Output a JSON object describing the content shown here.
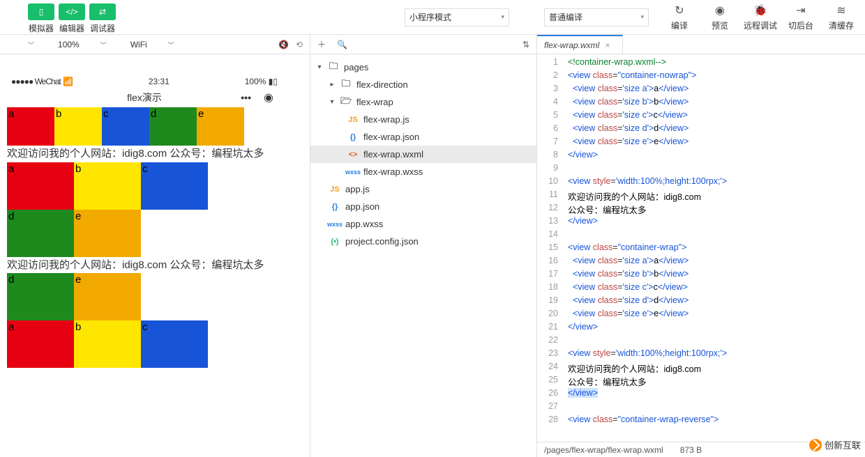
{
  "topbar": {
    "left": [
      {
        "icon": "phone-icon",
        "label": "模拟器"
      },
      {
        "icon": "code-icon",
        "label": "编辑器"
      },
      {
        "icon": "debug-icon",
        "label": "调试器"
      }
    ],
    "mode_select": "小程序模式",
    "compile_select": "普通编译",
    "right": [
      {
        "icon": "compile-icon",
        "glyph": "↻",
        "label": "编译"
      },
      {
        "icon": "preview-icon",
        "glyph": "◉",
        "label": "预览"
      },
      {
        "icon": "remote-debug-icon",
        "glyph": "⚙",
        "label": "远程调试"
      },
      {
        "icon": "background-icon",
        "glyph": "⇥",
        "label": "切后台"
      },
      {
        "icon": "cache-icon",
        "glyph": "≋",
        "label": "清缓存"
      }
    ]
  },
  "secondbar": {
    "zoom": "100%",
    "network": "WiFi",
    "mute_icon": "🔇",
    "cast_icon": "📡"
  },
  "simulator": {
    "status_left": "●●●●● WeChat",
    "wifi_icon": "📶",
    "time": "23:31",
    "battery_pct": "100%",
    "title": "flex演示",
    "welcome": "欢迎访问我的个人网站：idig8.com 公众号：编程坑太多",
    "row1": [
      "a",
      "b",
      "c",
      "d",
      "e"
    ],
    "row2": [
      "a",
      "b",
      "c"
    ],
    "row2b": [
      "d",
      "e"
    ],
    "row3_top": [
      "d",
      "e"
    ],
    "row3_bot": [
      "a",
      "b",
      "c"
    ]
  },
  "tree": {
    "root": "pages",
    "flex_direction": "flex-direction",
    "flex_wrap": "flex-wrap",
    "files": {
      "js": "flex-wrap.js",
      "json": "flex-wrap.json",
      "wxml": "flex-wrap.wxml",
      "wxss": "flex-wrap.wxss"
    },
    "app_js": "app.js",
    "app_json": "app.json",
    "app_wxss": "app.wxss",
    "project_config": "project.config.json"
  },
  "editor": {
    "tab_name": "flex-wrap.wxml",
    "status_path": "/pages/flex-wrap/flex-wrap.wxml",
    "status_size": "873 B",
    "lines": [
      {
        "n": 1,
        "html": "<span class='c-com'>&lt;!container-wrap.wxml--&gt;</span>"
      },
      {
        "n": 2,
        "html": "<span class='c-tag'>&lt;view</span> <span class='c-attr'>class</span>=<span class='c-str'>\"container-nowrap\"</span><span class='c-tag'>&gt;</span>"
      },
      {
        "n": 3,
        "html": "  <span class='c-tag'>&lt;view</span> <span class='c-attr'>class</span>=<span class='c-str'>'size a'</span><span class='c-tag'>&gt;</span><span class='c-txt'>a</span><span class='c-tag'>&lt;/view&gt;</span>"
      },
      {
        "n": 4,
        "html": "  <span class='c-tag'>&lt;view</span> <span class='c-attr'>class</span>=<span class='c-str'>'size b'</span><span class='c-tag'>&gt;</span><span class='c-txt'>b</span><span class='c-tag'>&lt;/view&gt;</span>"
      },
      {
        "n": 5,
        "html": "  <span class='c-tag'>&lt;view</span> <span class='c-attr'>class</span>=<span class='c-str'>'size c'</span><span class='c-tag'>&gt;</span><span class='c-txt'>c</span><span class='c-tag'>&lt;/view&gt;</span>"
      },
      {
        "n": 6,
        "html": "  <span class='c-tag'>&lt;view</span> <span class='c-attr'>class</span>=<span class='c-str'>'size d'</span><span class='c-tag'>&gt;</span><span class='c-txt'>d</span><span class='c-tag'>&lt;/view&gt;</span>"
      },
      {
        "n": 7,
        "html": "  <span class='c-tag'>&lt;view</span> <span class='c-attr'>class</span>=<span class='c-str'>'size e'</span><span class='c-tag'>&gt;</span><span class='c-txt'>e</span><span class='c-tag'>&lt;/view&gt;</span>"
      },
      {
        "n": 8,
        "html": "<span class='c-tag'>&lt;/view&gt;</span>"
      },
      {
        "n": 9,
        "html": ""
      },
      {
        "n": 10,
        "html": "<span class='c-tag'>&lt;view</span> <span class='c-attr'>style</span>=<span class='c-str'>'width:100%;height:100rpx;'</span><span class='c-tag'>&gt;</span>"
      },
      {
        "n": 11,
        "html": "<span class='c-txt'>欢迎访问我的个人网站：idig8.com</span>"
      },
      {
        "n": 12,
        "html": "<span class='c-txt'>公众号：编程坑太多</span>"
      },
      {
        "n": 13,
        "html": "<span class='c-tag'>&lt;/view&gt;</span>"
      },
      {
        "n": 14,
        "html": ""
      },
      {
        "n": 15,
        "html": "<span class='c-tag'>&lt;view</span> <span class='c-attr'>class</span>=<span class='c-str'>\"container-wrap\"</span><span class='c-tag'>&gt;</span>"
      },
      {
        "n": 16,
        "html": "  <span class='c-tag'>&lt;view</span> <span class='c-attr'>class</span>=<span class='c-str'>'size a'</span><span class='c-tag'>&gt;</span><span class='c-txt'>a</span><span class='c-tag'>&lt;/view&gt;</span>"
      },
      {
        "n": 17,
        "html": "  <span class='c-tag'>&lt;view</span> <span class='c-attr'>class</span>=<span class='c-str'>'size b'</span><span class='c-tag'>&gt;</span><span class='c-txt'>b</span><span class='c-tag'>&lt;/view&gt;</span>"
      },
      {
        "n": 18,
        "html": "  <span class='c-tag'>&lt;view</span> <span class='c-attr'>class</span>=<span class='c-str'>'size c'</span><span class='c-tag'>&gt;</span><span class='c-txt'>c</span><span class='c-tag'>&lt;/view&gt;</span>"
      },
      {
        "n": 19,
        "html": "  <span class='c-tag'>&lt;view</span> <span class='c-attr'>class</span>=<span class='c-str'>'size d'</span><span class='c-tag'>&gt;</span><span class='c-txt'>d</span><span class='c-tag'>&lt;/view&gt;</span>"
      },
      {
        "n": 20,
        "html": "  <span class='c-tag'>&lt;view</span> <span class='c-attr'>class</span>=<span class='c-str'>'size e'</span><span class='c-tag'>&gt;</span><span class='c-txt'>e</span><span class='c-tag'>&lt;/view&gt;</span>"
      },
      {
        "n": 21,
        "html": "<span class='c-tag'>&lt;/view&gt;</span>"
      },
      {
        "n": 22,
        "html": ""
      },
      {
        "n": 23,
        "html": "<span class='c-tag'>&lt;view</span> <span class='c-attr'>style</span>=<span class='c-str'>'width:100%;height:100rpx;'</span><span class='c-tag'>&gt;</span>"
      },
      {
        "n": 24,
        "html": "<span class='c-txt'>欢迎访问我的个人网站：idig8.com</span>"
      },
      {
        "n": 25,
        "html": "<span class='c-txt'>公众号：编程坑太多</span>"
      },
      {
        "n": 26,
        "html": "<span class='c-tag' style='background:#cfe3ff'>&lt;/view&gt;</span>"
      },
      {
        "n": 27,
        "html": ""
      },
      {
        "n": 28,
        "html": "<span class='c-tag'>&lt;view</span> <span class='c-attr'>class</span>=<span class='c-str'>\"container-wrap-reverse\"</span><span class='c-tag'>&gt;</span>"
      }
    ]
  },
  "watermark": "创新互联"
}
